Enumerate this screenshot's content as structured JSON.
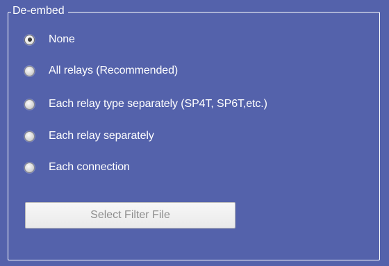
{
  "groupbox": {
    "title": "De-embed"
  },
  "options": [
    {
      "label": "None",
      "checked": true
    },
    {
      "label": "All relays (Recommended)",
      "checked": false
    },
    {
      "label": "Each relay type separately (SP4T, SP6T,etc.)",
      "checked": false
    },
    {
      "label": "Each relay separately",
      "checked": false
    },
    {
      "label": "Each connection",
      "checked": false
    }
  ],
  "select_filter_button": {
    "label": "Select Filter File",
    "enabled": false
  },
  "colors": {
    "panel_background": "#5462ab",
    "text": "#ffffff",
    "button_text_disabled": "#8c8c8c"
  }
}
